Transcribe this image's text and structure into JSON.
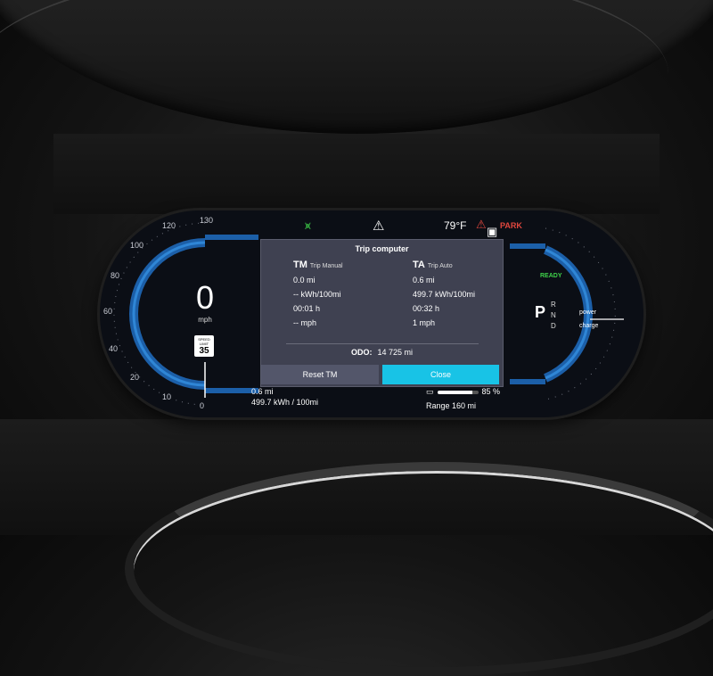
{
  "speedometer": {
    "ticks": [
      "0",
      "10",
      "20",
      "40",
      "60",
      "80",
      "100",
      "120",
      "130"
    ],
    "speed": "0",
    "unit": "mph",
    "speed_limit_label": "SPEED LIMIT",
    "speed_limit": "35"
  },
  "status_bar": {
    "lights_icon": "headlight-icon",
    "warning_icon": "warning-triangle-icon",
    "temperature": "79°F",
    "seatbelt_icon": "seatbelt-warning-icon",
    "car_icon": "car-top-icon",
    "park": "PARK"
  },
  "trip_computer": {
    "title": "Trip computer",
    "manual": {
      "code": "TM",
      "label": "Trip Manual",
      "distance": "0.0 mi",
      "energy": "-- kWh/100mi",
      "time": "00:01 h",
      "speed": "-- mph"
    },
    "auto": {
      "code": "TA",
      "label": "Trip Auto",
      "distance": "0.6 mi",
      "energy": "499.7 kWh/100mi",
      "time": "00:32 h",
      "speed": "1 mph"
    },
    "odo_label": "ODO:",
    "odo_value": "14 725 mi",
    "reset_button": "Reset TM",
    "close_button": "Close"
  },
  "trip_summary": {
    "distance": "0.6 mi",
    "energy": "499.7 kWh / 100mi"
  },
  "battery": {
    "percent": "85 %",
    "level": 0.85,
    "range": "Range 160 mi"
  },
  "drive": {
    "ready": "READY",
    "gear": "P",
    "gears": [
      "R",
      "N",
      "D"
    ],
    "power_label": "power",
    "charge_label": "charge"
  },
  "colors": {
    "accent_blue": "#2f86d6",
    "close_button": "#18c3e6",
    "ready_green": "#3fd24a",
    "warning_red": "#e0473e"
  }
}
